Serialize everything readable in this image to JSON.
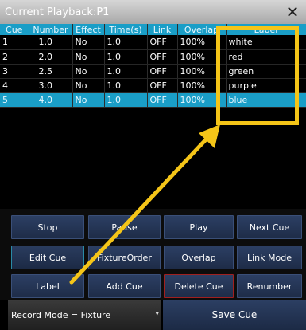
{
  "window": {
    "title": "Current Playback:P1",
    "close_glyph": "✕",
    "close_icon": "close-icon"
  },
  "table": {
    "headers": [
      "Cue",
      "Number",
      "Effect",
      "Time(s)",
      "Link",
      "Overlap",
      "Label"
    ],
    "rows": [
      {
        "cue": "1",
        "number": "1.0",
        "effect": "No",
        "time": "1.0",
        "link": "OFF",
        "overlap": "100%",
        "label": "white"
      },
      {
        "cue": "2",
        "number": "2.0",
        "effect": "No",
        "time": "1.0",
        "link": "OFF",
        "overlap": "100%",
        "label": "red"
      },
      {
        "cue": "3",
        "number": "2.5",
        "effect": "No",
        "time": "1.0",
        "link": "OFF",
        "overlap": "100%",
        "label": "green"
      },
      {
        "cue": "4",
        "number": "3.0",
        "effect": "No",
        "time": "1.0",
        "link": "OFF",
        "overlap": "100%",
        "label": "purple"
      },
      {
        "cue": "5",
        "number": "4.0",
        "effect": "No",
        "time": "1.0",
        "link": "OFF",
        "overlap": "100%",
        "label": "blue"
      }
    ],
    "selected_row": 4
  },
  "buttons": {
    "stop": "Stop",
    "pause": "Pause",
    "play": "Play",
    "next_cue": "Next Cue",
    "edit_cue": "Edit Cue",
    "fixture_order": "FixtureOrder",
    "overlap": "Overlap",
    "link_mode": "Link Mode",
    "label": "Label",
    "add_cue": "Add Cue",
    "delete_cue": "Delete Cue",
    "renumber": "Renumber"
  },
  "bottom": {
    "record_mode": "Record Mode = Fixture",
    "save_cue": "Save Cue"
  },
  "colors": {
    "accent": "#1a9ec7",
    "annotation": "#f5c518",
    "button": "#1e2c48",
    "delete_border": "#a02020"
  }
}
